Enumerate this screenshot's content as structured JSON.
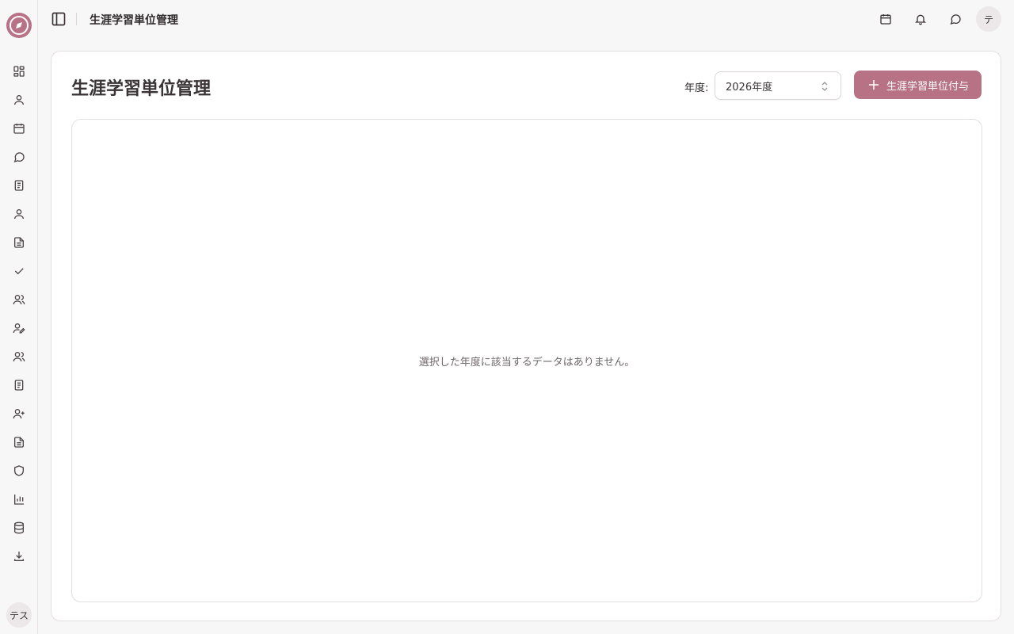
{
  "header": {
    "title": "生涯学習単位管理",
    "user_initial": "テ"
  },
  "sidebar": {
    "user_initials": "テス",
    "items": [
      {
        "icon": "dashboard-icon"
      },
      {
        "icon": "user-icon"
      },
      {
        "icon": "calendar-icon"
      },
      {
        "icon": "message-icon"
      },
      {
        "icon": "notebook-icon"
      },
      {
        "icon": "user-icon"
      },
      {
        "icon": "document-icon"
      },
      {
        "icon": "check-icon"
      },
      {
        "icon": "users-icon"
      },
      {
        "icon": "user-edit-icon"
      },
      {
        "icon": "users-icon"
      },
      {
        "icon": "notebook-icon"
      },
      {
        "icon": "user-plus-icon"
      },
      {
        "icon": "document-icon"
      },
      {
        "icon": "shield-icon"
      },
      {
        "icon": "bar-chart-icon"
      },
      {
        "icon": "database-icon"
      },
      {
        "icon": "download-icon"
      }
    ]
  },
  "main": {
    "title": "生涯学習単位管理",
    "year_label": "年度:",
    "year_selected": "2026年度",
    "add_button_label": "生涯学習単位付与",
    "empty_message": "選択した年度に該当するデータはありません。"
  },
  "colors": {
    "accent": "#b77385",
    "background": "#f8f7f7",
    "card": "#ffffff",
    "border": "#e3dfe0"
  }
}
